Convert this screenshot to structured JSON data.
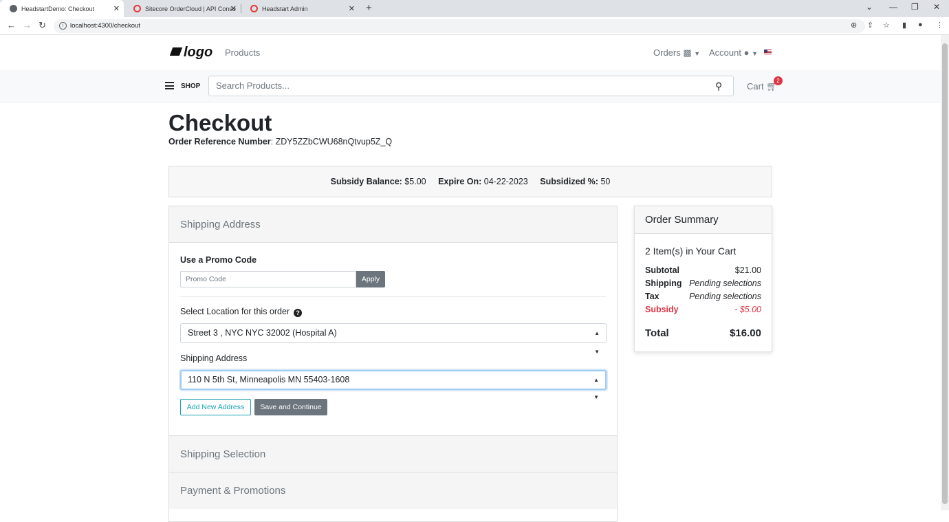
{
  "browser": {
    "tabs": [
      {
        "title": "HeadstartDemo: Checkout",
        "favicon_color": "#5f6368"
      },
      {
        "title": "Sitecore OrderCloud | API Conso",
        "favicon_color": "#e53935"
      },
      {
        "title": "Headstart Admin",
        "favicon_color": "#e53935"
      }
    ],
    "new_tab": "+",
    "url": "localhost:4300/checkout"
  },
  "header": {
    "logo_text": "logo",
    "nav_products": "Products",
    "orders": "Orders",
    "account": "Account",
    "shop_label": "SHOP",
    "search_placeholder": "Search Products...",
    "cart_label": "Cart",
    "cart_count": "2"
  },
  "page": {
    "title": "Checkout",
    "order_ref_label": "Order Reference Number",
    "order_ref_value": ": ZDY5ZZbCWU68nQtvup5Z_Q"
  },
  "subsidy": {
    "balance_label": "Subsidy Balance:",
    "balance_value": "$5.00",
    "expire_label": "Expire On:",
    "expire_value": "04-22-2023",
    "pct_label": "Subsidized %:",
    "pct_value": "50"
  },
  "checkout": {
    "shipping_address_header": "Shipping Address",
    "promo_label": "Use a Promo Code",
    "promo_placeholder": "Promo Code",
    "apply_button": "Apply",
    "location_label": "Select Location for this order",
    "location_value": "Street 3 , NYC NYC 32002 (Hospital A)",
    "shipping_address_label": "Shipping Address",
    "shipping_address_value": "110 N 5th St, Minneapolis MN 55403-1608",
    "add_address_button": "Add New Address",
    "save_continue_button": "Save and Continue",
    "shipping_selection_header": "Shipping Selection",
    "payment_header": "Payment & Promotions"
  },
  "summary": {
    "header": "Order Summary",
    "items_text": "2 Item(s) in Your Cart",
    "subtotal_label": "Subtotal",
    "subtotal_value": "$21.00",
    "shipping_label": "Shipping",
    "shipping_value": "Pending selections",
    "tax_label": "Tax",
    "tax_value": "Pending selections",
    "subsidy_label": "Subsidy",
    "subsidy_value": "- $5.00",
    "total_label": "Total",
    "total_value": "$16.00"
  }
}
